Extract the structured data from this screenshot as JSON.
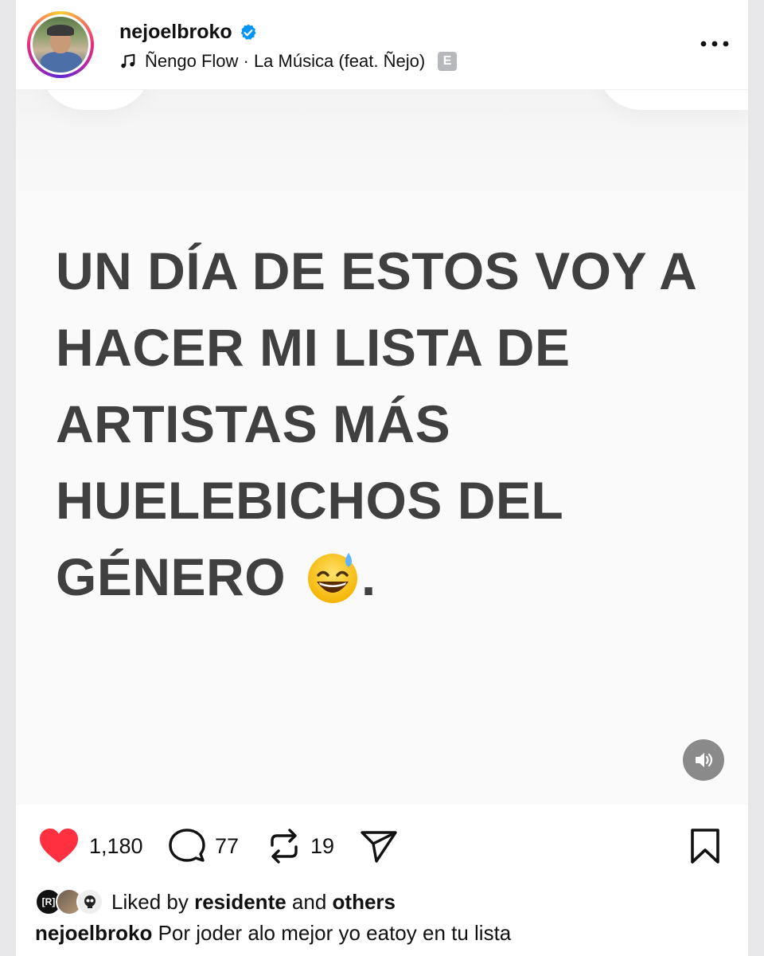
{
  "header": {
    "username": "nejoelbroko",
    "song": "Ñengo Flow · La Música (feat. Ñejo)",
    "explicit_badge": "E"
  },
  "post": {
    "lines": [
      "UN DÍA DE ESTOS VOY A",
      "HACER MI LISTA DE",
      "ARTISTAS MÁS",
      "HUELEBICHOS DEL",
      "GÉNERO"
    ],
    "trailing_punct": "."
  },
  "actions": {
    "likes": "1,180",
    "comments": "77",
    "reposts": "19"
  },
  "liked_by": {
    "avatar_label": "[R]",
    "prefix": "Liked by",
    "user": "residente",
    "conj": "and",
    "others": "others"
  },
  "caption": {
    "user": "nejoelbroko",
    "text": "Por joder alo mejor yo eatoy en tu lista"
  },
  "colors": {
    "like_red": "#ff3040",
    "verified_blue": "#0095f6",
    "text_dark": "#111111",
    "post_text_gray": "#404040"
  }
}
